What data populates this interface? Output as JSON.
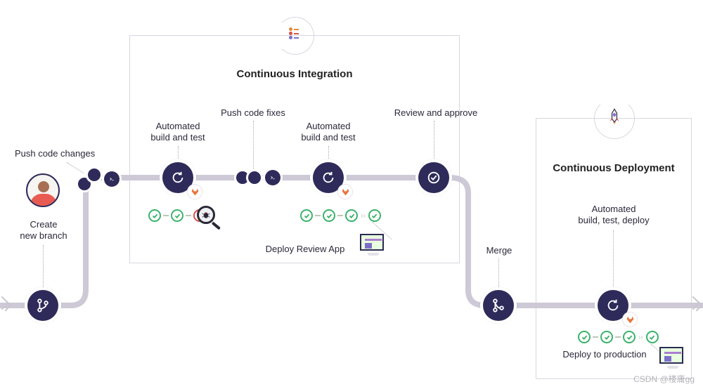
{
  "sections": {
    "ci": {
      "title": "Continuous Integration"
    },
    "cd": {
      "title": "Continuous Deployment"
    }
  },
  "stages": {
    "create_branch": "Create\nnew branch",
    "push_changes": "Push code changes",
    "automated_bt_1": "Automated\nbuild and test",
    "push_fixes": "Push code fixes",
    "automated_bt_2": "Automated\nbuild and test",
    "deploy_review_app": "Deploy Review App",
    "review_approve": "Review and approve",
    "merge": "Merge",
    "automated_btd": "Automated\nbuild, test, deploy",
    "deploy_production": "Deploy to production"
  },
  "icons": {
    "branch": "git-branch",
    "prompt": "terminal",
    "cycle": "refresh",
    "check": "checkmark",
    "cross": "x",
    "chevron": "chevron",
    "merge": "git-merge",
    "gitlab": "gitlab-fox",
    "bug": "bug",
    "magnifier": "magnifier",
    "desktop": "desktop",
    "rocket": "rocket",
    "list": "checklist",
    "avatar": "user-avatar"
  },
  "colors": {
    "pipe": "#cdc9d6",
    "node": "#2e2a5a",
    "success": "#3bb36b",
    "fail": "#d6524a",
    "orange": "#e68a3a",
    "purple": "#7d6fc9"
  },
  "watermark": "CSDN @楼庸gg"
}
